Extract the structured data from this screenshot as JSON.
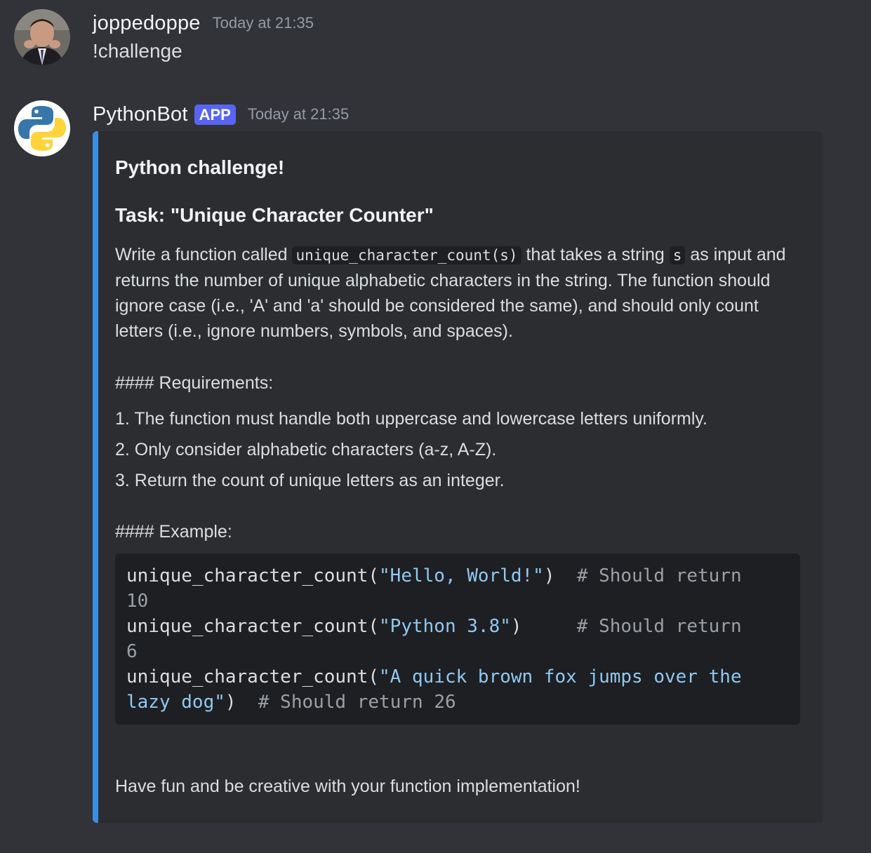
{
  "messages": [
    {
      "username": "joppedoppe",
      "timestamp": "Today at 21:35",
      "text": "!challenge"
    },
    {
      "username": "PythonBot",
      "badge": "APP",
      "timestamp": "Today at 21:35",
      "embed": {
        "accent_color": "#3b8fdf",
        "title": "Python challenge!",
        "task_heading": "Task: \"Unique Character Counter\"",
        "paragraph": {
          "p1": "Write a function called ",
          "code1": "unique_character_count(s)",
          "p2": " that takes a string ",
          "code2": "s",
          "p3": " as input and returns the number of unique alphabetic characters in the string. The function should ignore case (i.e., 'A' and 'a' should be considered the same), and should only count letters (i.e., ignore numbers, symbols, and spaces)."
        },
        "requirements_heading": "#### Requirements:",
        "requirements": [
          "1. The function must handle both uppercase and lowercase letters uniformly.",
          "2. Only consider alphabetic characters (a-z, A-Z).",
          "3. Return the count of unique letters as an integer."
        ],
        "example_heading": "#### Example:",
        "code_lines": [
          {
            "fn": "unique_character_count(",
            "str": "\"Hello, World!\"",
            "close": ")  ",
            "cmt": "# Should return"
          },
          {
            "fn": "",
            "str": "",
            "close": "",
            "cmt": "10"
          },
          {
            "fn": "unique_character_count(",
            "str": "\"Python 3.8\"",
            "close": ")     ",
            "cmt": "# Should return"
          },
          {
            "fn": "",
            "str": "",
            "close": "",
            "cmt": "6"
          },
          {
            "fn": "unique_character_count(",
            "str": "\"A quick brown fox jumps over the",
            "close": "",
            "cmt": ""
          },
          {
            "fn": "",
            "str": "lazy dog\"",
            "close": ")  ",
            "cmt": "# Should return 26"
          }
        ],
        "closing": "Have fun and be creative with your function implementation!"
      }
    }
  ]
}
